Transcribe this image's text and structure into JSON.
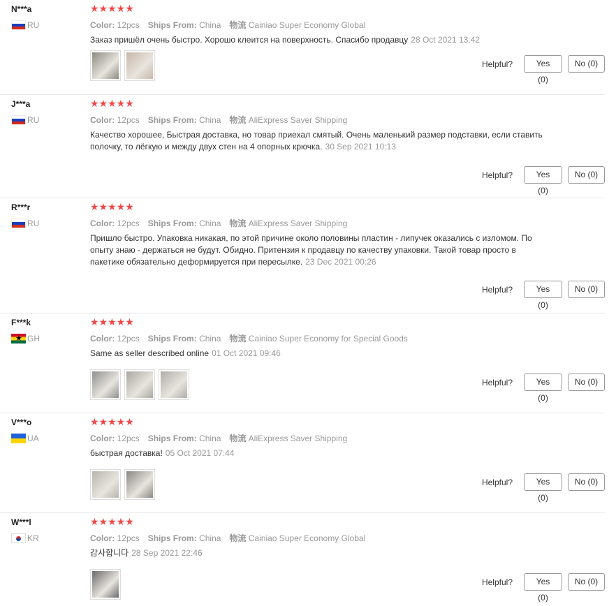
{
  "labels": {
    "color": "Color:",
    "ships_from": "Ships From:",
    "shipping": "物流",
    "helpful": "Helpful?"
  },
  "reviews": [
    {
      "user": "N***a",
      "country": "RU",
      "flag": "ru",
      "stars": "★★★★★",
      "color": "12pcs",
      "ships_from": "China",
      "shipping": "Cainiao Super Economy Global",
      "text": "Заказ пришёл очень быстро. Хорошо клеится на поверхность. Спасибо продавцу",
      "date": "28 Oct 2021 13:42",
      "yes": "Yes (0)",
      "no": "No (0)",
      "photos": [
        "#8c8a80",
        "#c8b8a8"
      ]
    },
    {
      "user": "J***a",
      "country": "RU",
      "flag": "ru",
      "stars": "★★★★★",
      "color": "12pcs",
      "ships_from": "China",
      "shipping": "AliExpress Saver Shipping",
      "text": "Качество хорошее, Быстрая доставка, но товар приехал смятый. Очень маленький размер подставки, если ставить полочку, то лёгкую и между двух стен на 4 опорных крючка.",
      "date": "30 Sep 2021 10:13",
      "yes": "Yes (0)",
      "no": "No (0)",
      "photos": []
    },
    {
      "user": "R***r",
      "country": "RU",
      "flag": "ru",
      "stars": "★★★★★",
      "color": "12pcs",
      "ships_from": "China",
      "shipping": "AliExpress Saver Shipping",
      "text": "Пришло быстро. Упаковка никакая, по этой причине около половины пластин - липучек оказались с изломом. По опыту знаю - держаться не будут. Обидно. Притензия к продавцу по качеству упаковки. Такой товар просто в пакетике обязательно деформируется при пересылке.",
      "date": "23 Dec 2021 00:26",
      "yes": "Yes (0)",
      "no": "No (0)",
      "photos": []
    },
    {
      "user": "F***k",
      "country": "GH",
      "flag": "gh",
      "stars": "★★★★★",
      "color": "12pcs",
      "ships_from": "China",
      "shipping": "Cainiao Super Economy for Special Goods",
      "text": "Same as seller described online",
      "date": "01 Oct 2021 09:46",
      "yes": "Yes (0)",
      "no": "No (0)",
      "photos": [
        "#8e9090",
        "#a8a8a0",
        "#b0aca8"
      ]
    },
    {
      "user": "V***o",
      "country": "UA",
      "flag": "ua",
      "stars": "★★★★★",
      "color": "12pcs",
      "ships_from": "China",
      "shipping": "AliExpress Saver Shipping",
      "text": "быстрая доставка!",
      "date": "05 Oct 2021 07:44",
      "yes": "Yes (0)",
      "no": "No (0)",
      "photos": [
        "#b8b4ae",
        "#8a8884"
      ]
    },
    {
      "user": "W***l",
      "country": "KR",
      "flag": "kr",
      "stars": "★★★★★",
      "color": "12pcs",
      "ships_from": "China",
      "shipping": "Cainiao Super Economy Global",
      "text": "감사합니다",
      "date": "28 Sep 2021 22:46",
      "yes": "Yes (0)",
      "no": "No (0)",
      "photos": [
        "#6a6a6a"
      ]
    }
  ]
}
